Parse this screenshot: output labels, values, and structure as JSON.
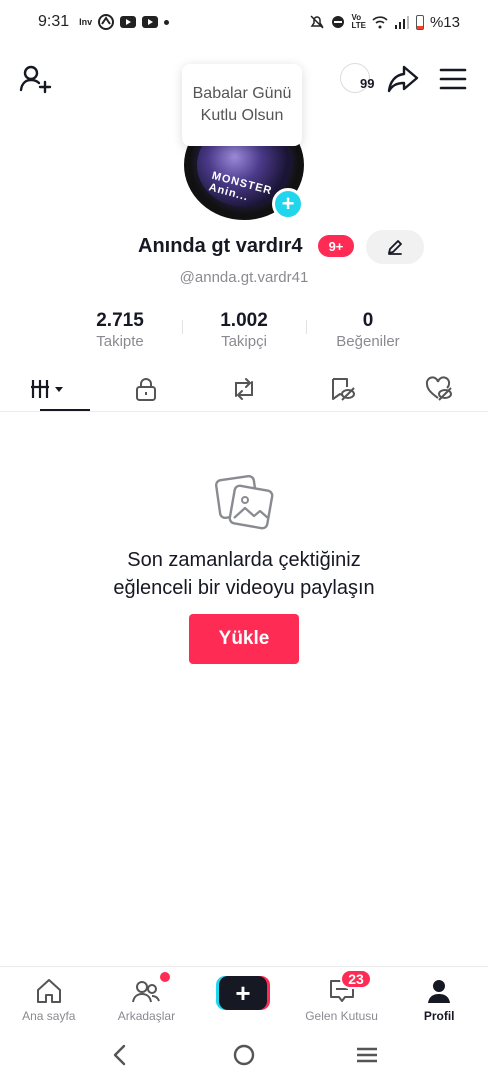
{
  "status_bar": {
    "time": "9:31",
    "carrier_tag": "Inv",
    "battery_text": "%13",
    "icons": [
      "navigation-icon",
      "youtube-icon",
      "youtube-icon",
      "dot-icon",
      "mute-icon",
      "do-not-disturb-icon",
      "volte-icon",
      "wifi-icon",
      "signal-icon",
      "battery-icon"
    ]
  },
  "top_bar": {
    "add_friend_icon": "add-user-icon",
    "notification_count": "99",
    "share_icon": "share-icon",
    "menu_icon": "hamburger-menu-icon"
  },
  "tooltip": {
    "text": "Babalar Günü Kutlu Olsun"
  },
  "avatar": {
    "overlay_text": "MONSTER Anin...",
    "plus_icon": "+"
  },
  "profile": {
    "username": "Anında gt vardır4",
    "badge": "9+",
    "handle": "@annda.gt.vardr41",
    "edit_icon": "pencil-icon"
  },
  "stats": [
    {
      "value": "2.715",
      "label": "Takipte"
    },
    {
      "value": "1.002",
      "label": "Takipçi"
    },
    {
      "value": "0",
      "label": "Beğeniler"
    }
  ],
  "tabs": [
    {
      "icon": "grid-icon",
      "active": true
    },
    {
      "icon": "lock-icon",
      "active": false
    },
    {
      "icon": "repost-icon",
      "active": false
    },
    {
      "icon": "bookmark-icon",
      "active": false
    },
    {
      "icon": "liked-icon",
      "active": false
    }
  ],
  "empty_state": {
    "icon": "photo-icon",
    "message": "Son zamanlarda çektiğiniz eğlenceli bir videoyu paylaşın",
    "button_label": "Yükle"
  },
  "bottom_nav": {
    "home_label": "Ana sayfa",
    "friends_label": "Arkadaşlar",
    "create_label": "+",
    "inbox_label": "Gelen Kutusu",
    "inbox_badge": "23",
    "profile_label": "Profil"
  },
  "colors": {
    "accent": "#fe2c55",
    "cyan": "#20d5ec",
    "text": "#161823",
    "muted": "#8a8b91"
  }
}
